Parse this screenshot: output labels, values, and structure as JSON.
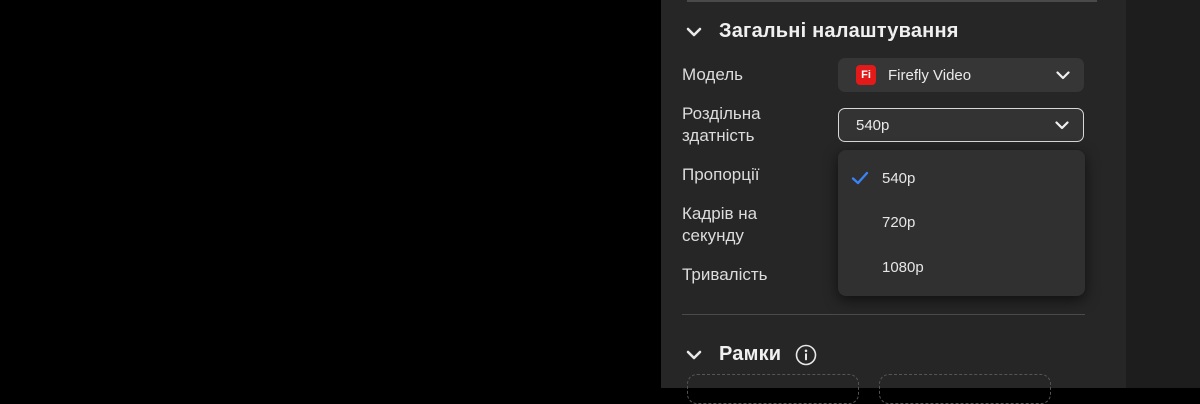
{
  "general_settings": {
    "title": "Загальні налаштування",
    "model": {
      "label": "Модель",
      "badge": "Fi",
      "value": "Firefly Video"
    },
    "resolution": {
      "label_line1": "Роздільна",
      "label_line2": "здатність",
      "value": "540p",
      "options": [
        "540p",
        "720p",
        "1080p"
      ],
      "selected": "540p"
    },
    "aspect_ratio": {
      "label": "Пропорції"
    },
    "fps": {
      "label_line1": "Кадрів на",
      "label_line2": "секунду"
    },
    "duration": {
      "label": "Тривалість"
    }
  },
  "frames": {
    "title": "Рамки"
  },
  "colors": {
    "accent_check": "#3b82f6",
    "brand_red": "#e21a1a"
  }
}
